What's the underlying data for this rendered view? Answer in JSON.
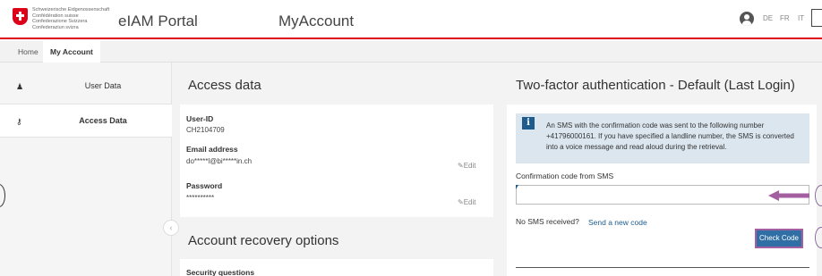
{
  "header": {
    "confederation_lines": [
      "Schweizerische Eidgenossenschaft",
      "Confédération suisse",
      "Confederazione Svizzera",
      "Confederaziun svizra"
    ],
    "app_title": "eIAM Portal",
    "section_title": "MyAccount",
    "languages": [
      "DE",
      "FR",
      "IT"
    ],
    "icons": {
      "logo": "swiss-flag-icon",
      "user": "user-circle-icon"
    },
    "accent_color": "#dc0018"
  },
  "tabs": [
    {
      "label": "Home",
      "active": false
    },
    {
      "label": "My Account",
      "active": true
    }
  ],
  "sidebar": {
    "items": [
      {
        "label": "User Data",
        "icon": "user-icon",
        "glyph": "♟",
        "active": false
      },
      {
        "label": "Access Data",
        "icon": "key-icon",
        "glyph": "⚷",
        "active": true
      }
    ],
    "collapse_glyph": "‹"
  },
  "access_data": {
    "title": "Access data",
    "user_id_label": "User-ID",
    "user_id_value": "CH2104709",
    "email_label": "Email address",
    "email_value": "do*****l@bi*****in.ch",
    "password_label": "Password",
    "password_value": "**********",
    "edit_label": "Edit",
    "edit_icon": "pencil-icon"
  },
  "recovery": {
    "title": "Account recovery options",
    "security_questions_label": "Security questions"
  },
  "two_factor": {
    "title": "Two-factor authentication - Default (Last Login)",
    "info_icon_glyph": "i",
    "info_text": "An SMS with the confirmation code was sent to the following number +41796000161. If you have specified a landline number, the SMS is converted into a voice message and read aloud during the retrieval.",
    "code_label": "Confirmation code from SMS",
    "code_value": "",
    "no_sms_label": "No SMS received?",
    "send_new_label": "Send a new code",
    "check_button": "Check Code",
    "annotation_color": "#8a6a9a"
  }
}
